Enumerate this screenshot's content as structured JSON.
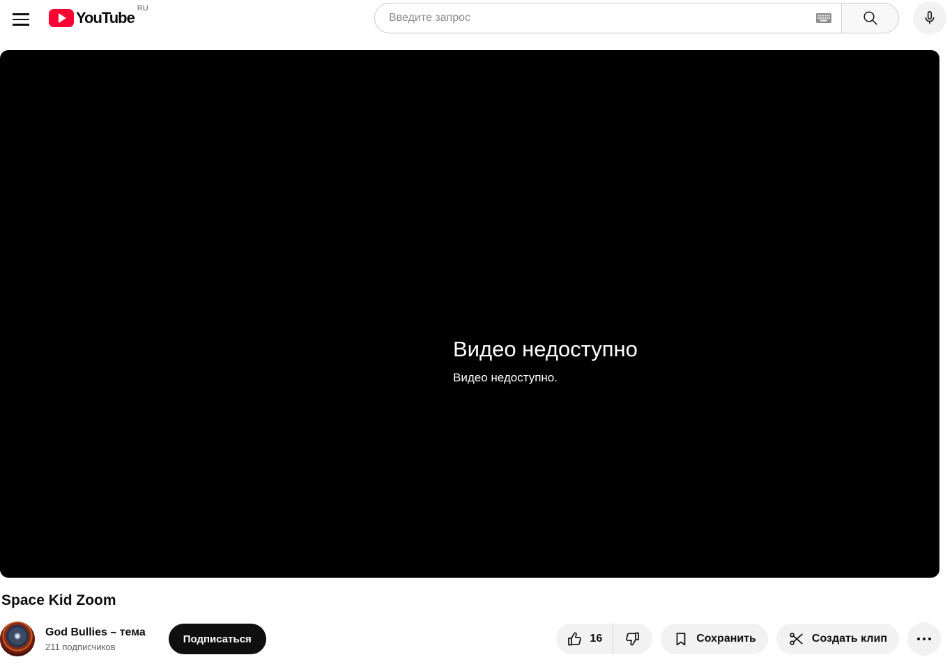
{
  "header": {
    "logo": {
      "wordmark": "YouTube",
      "region": "RU"
    },
    "search": {
      "placeholder": "Введите запрос"
    }
  },
  "player": {
    "error_title": "Видео недоступно",
    "error_subtitle": "Видео недоступно."
  },
  "video": {
    "title": "Space Kid Zoom",
    "channel": {
      "name": "God Bullies – тема",
      "subscribers": "211 подписчиков"
    },
    "subscribe_label": "Подписаться",
    "actions": {
      "like_count": "16",
      "save_label": "Сохранить",
      "clip_label": "Создать клип"
    }
  },
  "colors": {
    "brand_red": "#ff0033",
    "player_bg": "#000000",
    "pill_bg": "#f2f2f2",
    "subscribe_bg": "#0f0f0f",
    "text_primary": "#0f0f0f",
    "text_secondary": "#606060"
  }
}
